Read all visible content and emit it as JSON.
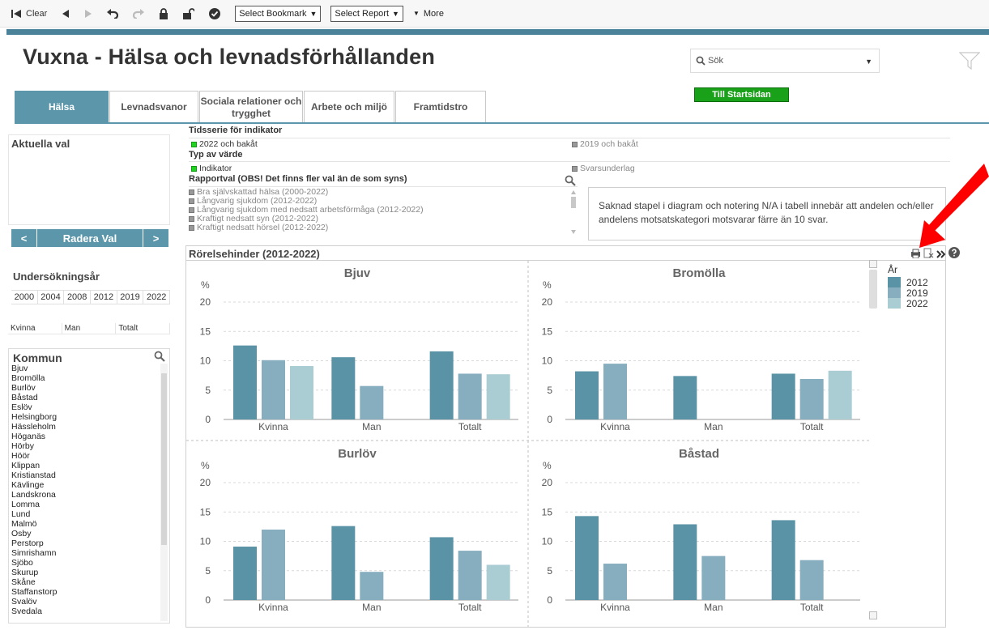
{
  "toolbar": {
    "clear_label": "Clear",
    "bookmark_label": "Select Bookmark",
    "report_label": "Select Report",
    "more_label": "More"
  },
  "page": {
    "title": "Vuxna - Hälsa och levnadsförhållanden",
    "search_placeholder": "Sök",
    "home_button": "Till Startsidan"
  },
  "tabs": [
    {
      "label": "Hälsa",
      "active": true
    },
    {
      "label": "Levnadsvanor"
    },
    {
      "label": "Sociala relationer och trygghet"
    },
    {
      "label": "Arbete och miljö"
    },
    {
      "label": "Framtidstro"
    }
  ],
  "sidebar": {
    "current_title": "Aktuella val",
    "prev_label": "<",
    "clear_label": "Radera Val",
    "next_label": ">",
    "year_title": "Undersökningsår",
    "years": [
      "2000",
      "2004",
      "2008",
      "2012",
      "2019",
      "2022"
    ],
    "genders": [
      "Kvinna",
      "Man",
      "Totalt"
    ],
    "kommun_title": "Kommun",
    "kommuner": [
      "Bjuv",
      "Bromölla",
      "Burlöv",
      "Båstad",
      "Eslöv",
      "Helsingborg",
      "Hässleholm",
      "Höganäs",
      "Hörby",
      "Höör",
      "Klippan",
      "Kristianstad",
      "Kävlinge",
      "Landskrona",
      "Lomma",
      "Lund",
      "Malmö",
      "Osby",
      "Perstorp",
      "Simrishamn",
      "Sjöbo",
      "Skurup",
      "Skåne",
      "Staffanstorp",
      "Svalöv",
      "Svedala"
    ]
  },
  "filters": {
    "timeseries_title": "Tidsserie för indikator",
    "timeseries_options": [
      "2022 och bakåt",
      "2019 och bakåt"
    ],
    "valuetype_title": "Typ av värde",
    "valuetype_options": [
      "Indikator",
      "Svarsunderlag"
    ],
    "report_title": "Rapportval (OBS! Det finns fler val än de som syns)",
    "report_options": [
      "Bra självskattad hälsa (2000-2022)",
      "Långvarig sjukdom (2012-2022)",
      "Långvarig sjukdom med nedsatt arbetsförmåga (2012-2022)",
      "Kraftigt nedsatt syn (2012-2022)",
      "Kraftigt nedsatt hörsel (2012-2022)"
    ],
    "note": "Saknad stapel i diagram och notering N/A i tabell innebär att andelen och/eller andelens motsatskategori motsvarar färre än 10 svar."
  },
  "chart_title": "Rörelsehinder (2012-2022)",
  "colors": {
    "accent": "#5b96ab",
    "home": "#1aa11a",
    "arrow": "#ff0000"
  },
  "chart_data": {
    "type": "bar",
    "legend_title": "År",
    "series_names": [
      "2012",
      "2019",
      "2022"
    ],
    "series_colors": [
      "#5b93a6",
      "#86aebe",
      "#a9cdd3"
    ],
    "categories": [
      "Kvinna",
      "Man",
      "Totalt"
    ],
    "ylabel": "%",
    "ylim": [
      0,
      20
    ],
    "yticks": [
      0,
      5,
      10,
      15,
      20
    ],
    "legend_position": "top-right",
    "panels": [
      {
        "title": "Bjuv",
        "values": [
          [
            12.6,
            10.1,
            9.1
          ],
          [
            10.6,
            5.7,
            null
          ],
          [
            11.6,
            7.8,
            7.7
          ]
        ]
      },
      {
        "title": "Bromölla",
        "values": [
          [
            8.2,
            9.5,
            null
          ],
          [
            7.4,
            null,
            null
          ],
          [
            7.8,
            6.9,
            8.3
          ]
        ]
      },
      {
        "title": "Burlöv",
        "values": [
          [
            9.1,
            12.0,
            null
          ],
          [
            12.6,
            4.8,
            null
          ],
          [
            10.7,
            8.4,
            6.0
          ]
        ]
      },
      {
        "title": "Båstad",
        "values": [
          [
            14.3,
            6.2,
            null
          ],
          [
            12.9,
            7.5,
            null
          ],
          [
            13.6,
            6.8,
            null
          ]
        ]
      }
    ]
  }
}
